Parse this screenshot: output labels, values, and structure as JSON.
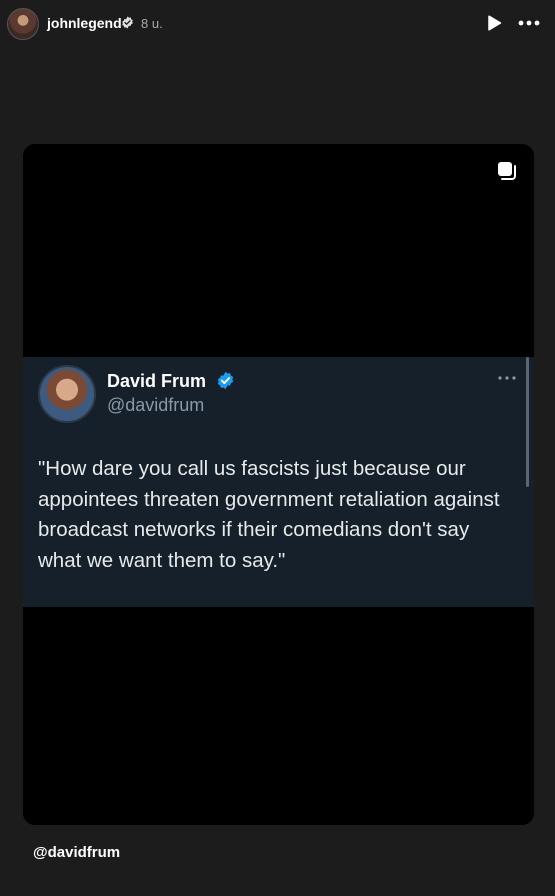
{
  "header": {
    "username": "johnlegend",
    "time": "8 u."
  },
  "tweet": {
    "name": "David Frum",
    "handle": "@davidfrum",
    "text": "\"How dare you call us fascists just because our appointees threaten government retaliation against broadcast networks if their comedians don't say what we want them to say.\""
  },
  "caption": {
    "mention": "@davidfrum"
  },
  "colors": {
    "background": "#1c1c1c",
    "tweet_background": "#15202b",
    "verified": "#1d9bf0"
  }
}
